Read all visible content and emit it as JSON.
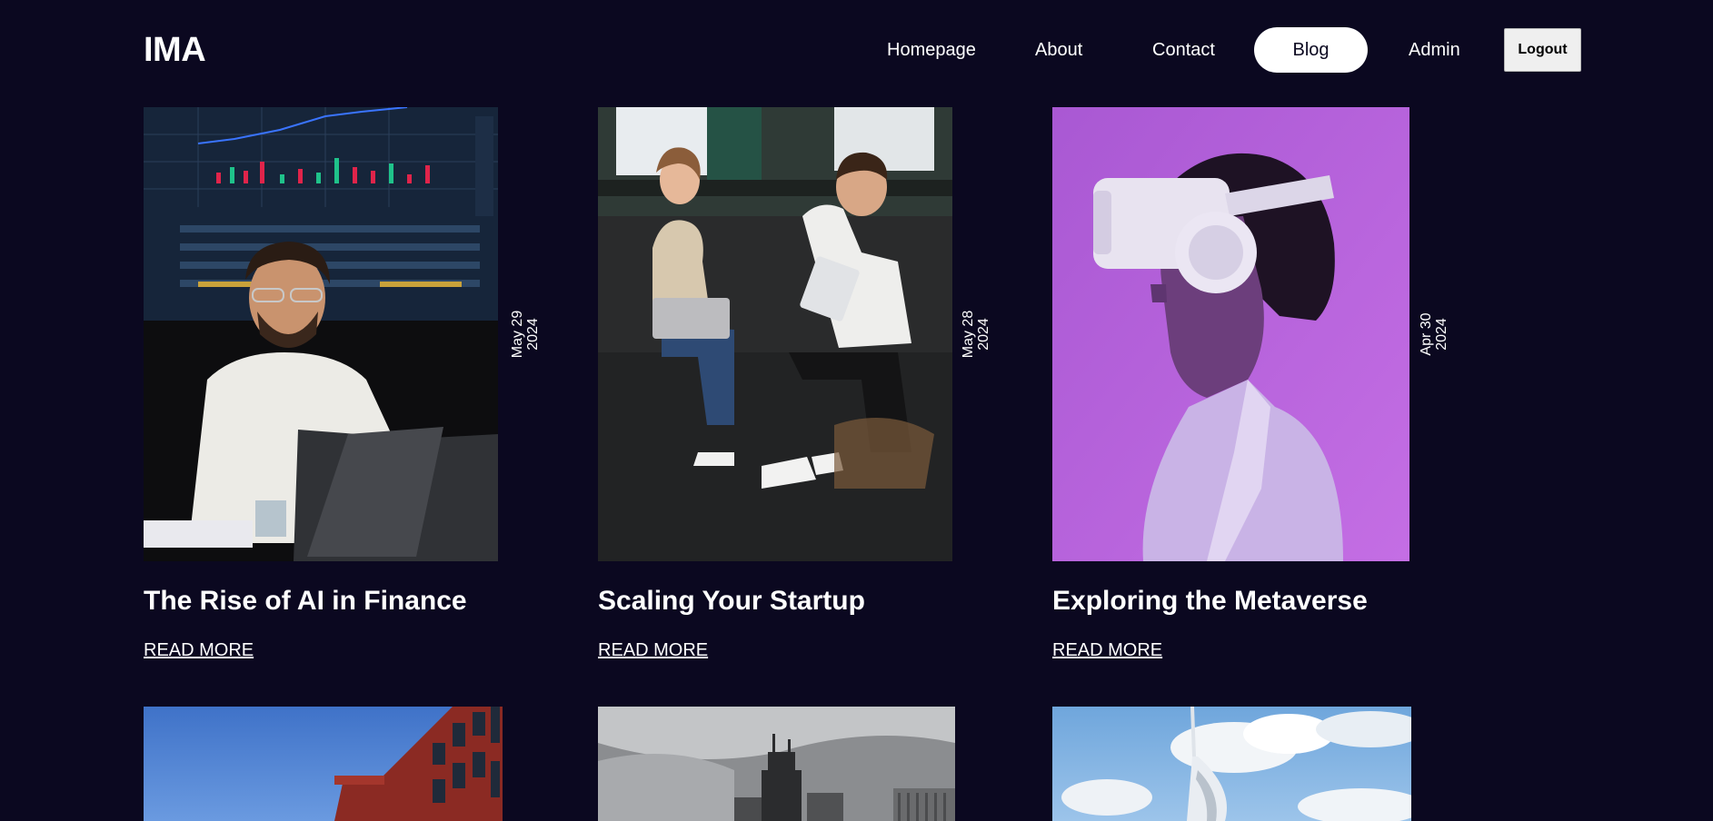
{
  "header": {
    "logo": "IMA",
    "nav": [
      {
        "label": "Homepage",
        "active": false
      },
      {
        "label": "About",
        "active": false
      },
      {
        "label": "Contact",
        "active": false
      },
      {
        "label": "Blog",
        "active": true
      },
      {
        "label": "Admin",
        "active": false
      }
    ],
    "logout_label": "Logout"
  },
  "posts": [
    {
      "title": "The Rise of AI in Finance",
      "date_line1": "May 29",
      "date_line2": "2024",
      "read_more": "READ MORE",
      "image": "man-at-laptop-trading-screen-photo"
    },
    {
      "title": "Scaling Your Startup",
      "date_line1": "May 28",
      "date_line2": "2024",
      "read_more": "READ MORE",
      "image": "two-people-meeting-with-laptop-and-tablet-photo"
    },
    {
      "title": "Exploring the Metaverse",
      "date_line1": "Apr 30",
      "date_line2": "2024",
      "read_more": "READ MORE",
      "image": "woman-with-vr-headset-purple-photo"
    },
    {
      "image": "red-brick-building-blue-sky-photo"
    },
    {
      "image": "city-skyline-grayscale-photo"
    },
    {
      "image": "white-tower-sky-clouds-photo"
    }
  ],
  "colors": {
    "background": "#0b0820",
    "text": "#ffffff",
    "active_nav_bg": "#ffffff"
  }
}
